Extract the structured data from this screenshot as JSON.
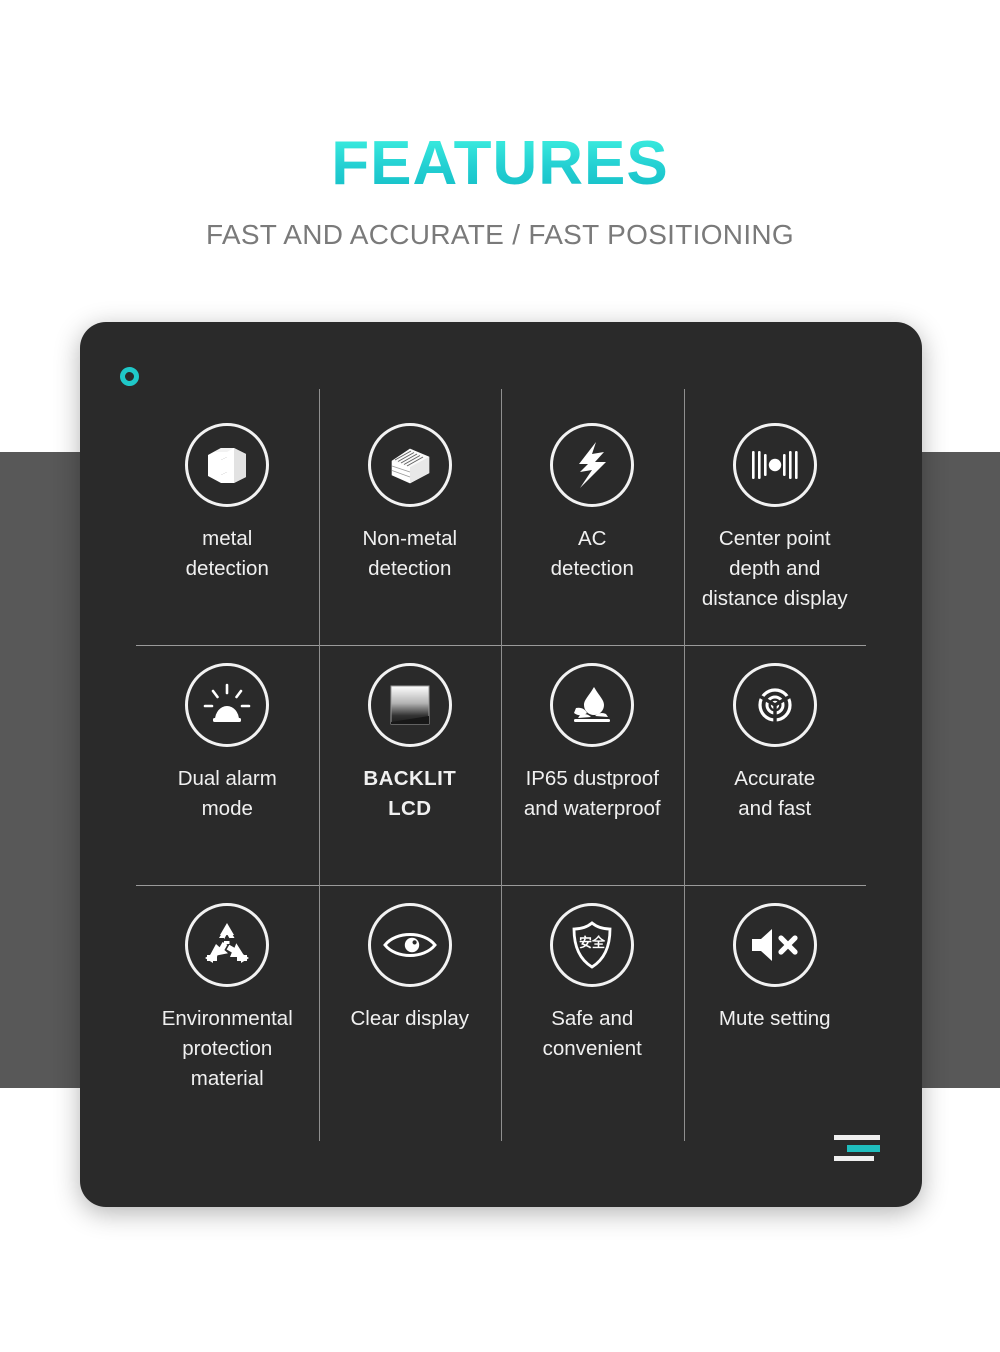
{
  "header": {
    "title": "FEATURES",
    "subtitle": "FAST AND ACCURATE / FAST POSITIONING",
    "title_color": "#23cfd2",
    "subtitle_color": "#7a7a7a"
  },
  "card": {
    "background_color": "#2a2a2a",
    "accent_color": "#1fc8c8",
    "corner_ring_name": "ring-marker",
    "corner_menu_name": "menu-marker"
  },
  "background": {
    "page_color": "#ffffff",
    "band_color": "#585858"
  },
  "features": [
    [
      {
        "label": "metal\ndetection",
        "icon": "i-beam-icon",
        "bold": false
      },
      {
        "label": "Non-metal\ndetection",
        "icon": "timber-stack-icon",
        "bold": false
      },
      {
        "label": "AC\ndetection",
        "icon": "lightning-bolt-icon",
        "bold": false
      },
      {
        "label": "Center point\ndepth and\ndistance display",
        "icon": "center-point-scale-icon",
        "bold": false
      }
    ],
    [
      {
        "label": "Dual alarm\nmode",
        "icon": "alarm-beacon-icon",
        "bold": false
      },
      {
        "label": "BACKLIT\nLCD",
        "icon": "lcd-screen-icon",
        "bold": true
      },
      {
        "label": "IP65 dustproof\nand waterproof",
        "icon": "water-drop-icon",
        "bold": false
      },
      {
        "label": "Accurate\nand fast",
        "icon": "radar-target-icon",
        "bold": false
      }
    ],
    [
      {
        "label": "Environmental\nprotection\nmaterial",
        "icon": "recycle-icon",
        "bold": false
      },
      {
        "label": "Clear display",
        "icon": "eye-icon",
        "bold": false
      },
      {
        "label": "Safe and\nconvenient",
        "icon": "shield-safety-icon",
        "bold": false,
        "icon_text": "安全"
      },
      {
        "label": "Mute setting",
        "icon": "mute-speaker-icon",
        "bold": false
      }
    ]
  ]
}
